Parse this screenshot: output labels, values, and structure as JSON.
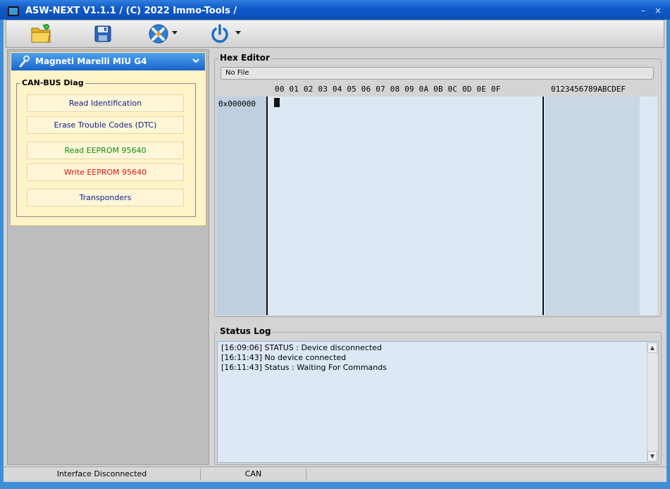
{
  "titlebar": {
    "title": "ASW-NEXT V1.1.1 / (C) 2022 Immo-Tools /",
    "minimize": "–",
    "close": "×"
  },
  "toolbar": {
    "buttons": [
      {
        "name": "open-folder-icon",
        "has_dropdown": false
      },
      {
        "name": "save-icon",
        "has_dropdown": false
      },
      {
        "name": "tools-icon",
        "has_dropdown": true
      },
      {
        "name": "power-icon",
        "has_dropdown": true
      }
    ]
  },
  "device": {
    "title": "Magneti Marelli MIU G4",
    "group_title": "CAN-BUS Diag",
    "actions": {
      "read_id": "Read Identification",
      "erase_dtc": "Erase Trouble Codes (DTC)",
      "read_eeprom": "Read EEPROM 95640",
      "write_eeprom": "Write EEPROM 95640",
      "transponders": "Transponders"
    },
    "colors": {
      "blue": "#10208a",
      "green": "#138a13",
      "red": "#e01414"
    }
  },
  "hex_editor": {
    "title": "Hex Editor",
    "file": "No File",
    "offsets": "00 01 02 03 04 05 06 07 08 09 0A 0B 0C 0D 0E 0F",
    "ascii_header": "0123456789ABCDEF",
    "first_address": "0x000000"
  },
  "status_log": {
    "title": "Status Log",
    "lines": [
      "[16:09:06] STATUS : Device disconnected",
      "[16:11:43] No device connected",
      "[16:11:43] Status : Waiting For Commands"
    ]
  },
  "statusbar": {
    "interface": "Interface Disconnected",
    "protocol": "CAN"
  }
}
